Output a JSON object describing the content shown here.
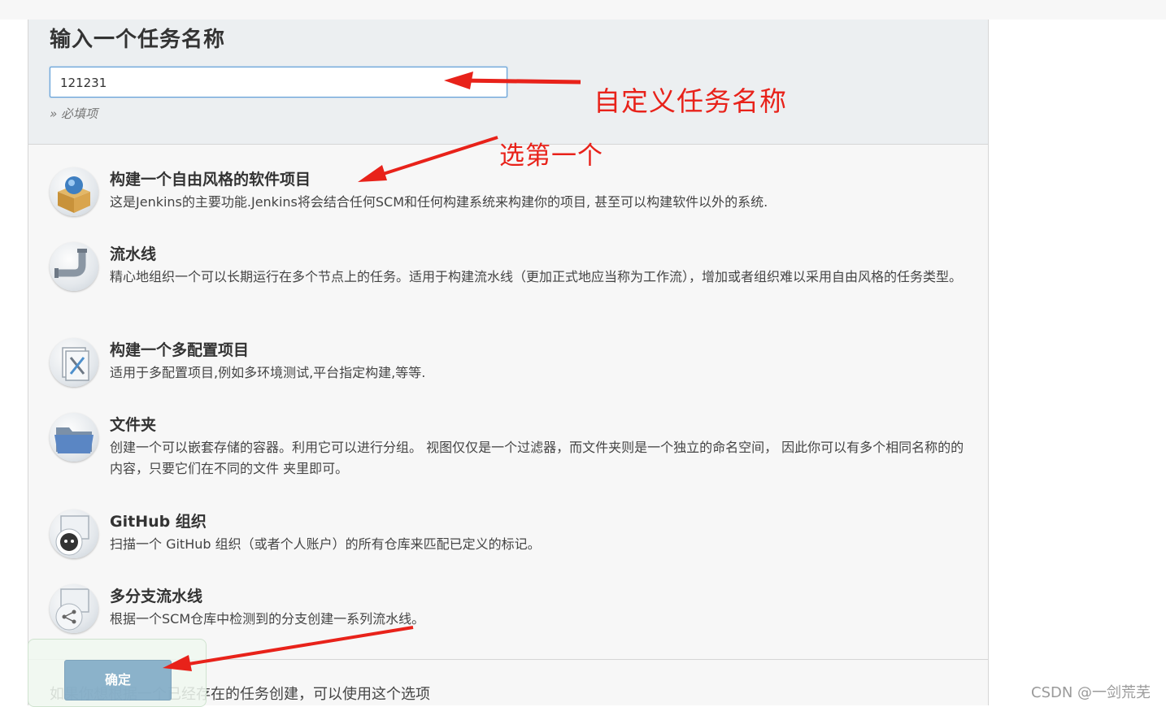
{
  "page": {
    "title": "输入一个任务名称",
    "task_name_value": "121231",
    "required_hint": "» 必填项"
  },
  "items": [
    {
      "title": "构建一个自由风格的软件项目",
      "desc": "这是Jenkins的主要功能.Jenkins将会结合任何SCM和任何构建系统来构建你的项目, 甚至可以构建软件以外的系统.",
      "icon": "freestyle-box-icon"
    },
    {
      "title": "流水线",
      "desc": "精心地组织一个可以长期运行在多个节点上的任务。适用于构建流水线（更加正式地应当称为工作流），增加或者组织难以采用自由风格的任务类型。",
      "icon": "pipeline-pipe-icon"
    },
    {
      "title": "构建一个多配置项目",
      "desc": "适用于多配置项目,例如多环境测试,平台指定构建,等等.",
      "icon": "multi-config-tools-icon"
    },
    {
      "title": "文件夹",
      "desc": "创建一个可以嵌套存储的容器。利用它可以进行分组。 视图仅仅是一个过滤器，而文件夹则是一个独立的命名空间， 因此你可以有多个相同名称的的内容，只要它们在不同的文件 夹里即可。",
      "icon": "folder-icon"
    },
    {
      "title": "GitHub 组织",
      "desc": "扫描一个 GitHub 组织（或者个人账户）的所有仓库来匹配已定义的标记。",
      "icon": "github-org-icon"
    },
    {
      "title": "多分支流水线",
      "desc": "根据一个SCM仓库中检测到的分支创建一系列流水线。",
      "icon": "multibranch-icon"
    }
  ],
  "copy_section": {
    "text": "如果你想根据一个已经存在的任务创建，可以使用这个选项"
  },
  "ok_button": {
    "label": "确定"
  },
  "annotations": {
    "custom_name": "自定义任务名称",
    "pick_first": "选第一个",
    "color": "#e8221a"
  },
  "watermark": "CSDN @一剑荒芜"
}
